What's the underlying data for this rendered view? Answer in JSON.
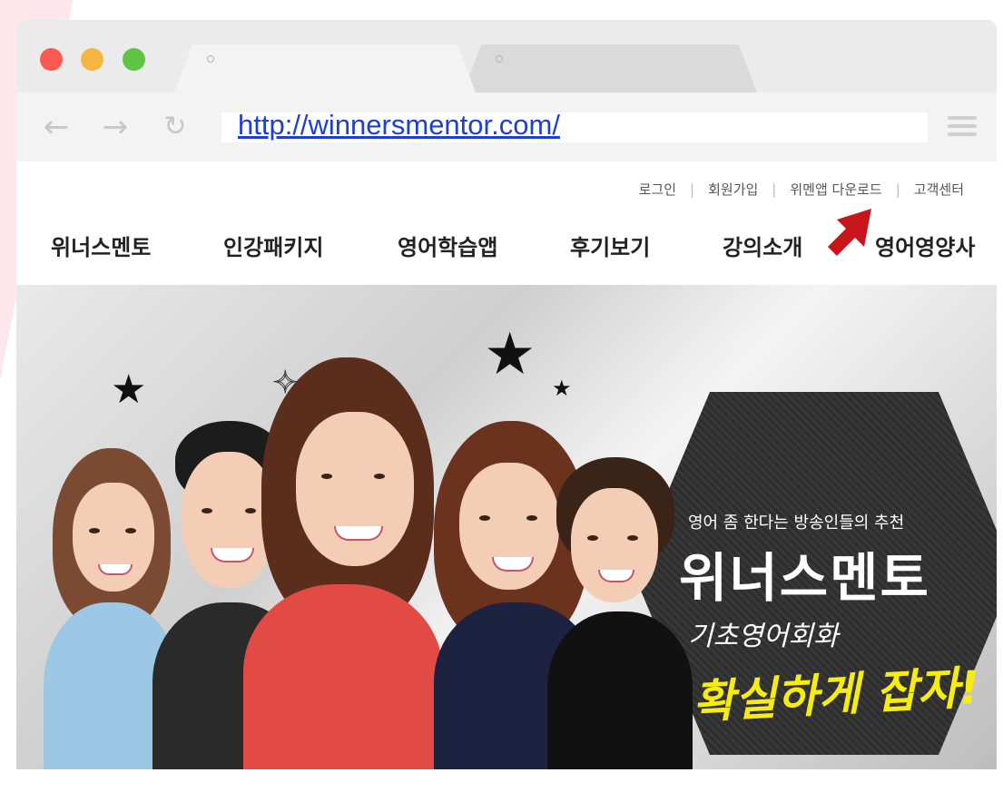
{
  "browser": {
    "url": "http://winnersmentor.com/",
    "nav_icons": [
      "arrow-left-icon",
      "arrow-right-icon",
      "reload-icon",
      "hamburger-menu-icon"
    ]
  },
  "site": {
    "util_links": [
      "로그인",
      "회원가입",
      "위멘앱 다운로드",
      "고객센터"
    ],
    "main_nav": [
      "위너스멘토",
      "인강패키지",
      "영어학습앱",
      "후기보기",
      "강의소개",
      "영어영양사"
    ],
    "annotation": "red-arrow-icon pointing to 위멘앱 다운로드"
  },
  "hero": {
    "subtitle": "영어 좀 한다는 방송인들의 추천",
    "title": "위너스멘토",
    "tagline_1": "기초영어회화",
    "tagline_2": "확실하게 잡자!",
    "colors": {
      "tagline_2": "#f6ec12",
      "title": "#ffffff",
      "hexagon": "#333333"
    }
  }
}
